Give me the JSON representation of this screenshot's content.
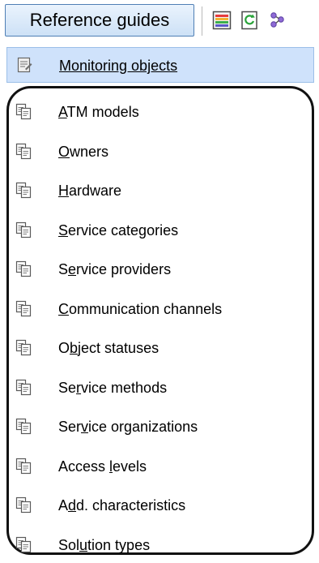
{
  "toolbar": {
    "reference_button_label": "Reference guides",
    "icons": [
      "list-view-icon",
      "refresh-icon",
      "flow-icon"
    ]
  },
  "selected_item": {
    "label": "Monitoring objects",
    "icon": "monitoring-objects-icon"
  },
  "items": [
    {
      "label": "ATM models",
      "underline_index": 0,
      "icon": "document-copy-icon"
    },
    {
      "label": "Owners",
      "underline_index": 0,
      "icon": "document-copy-icon"
    },
    {
      "label": "Hardware",
      "underline_index": 0,
      "icon": "document-copy-icon"
    },
    {
      "label": "Service categories",
      "underline_index": 0,
      "icon": "document-copy-icon"
    },
    {
      "label": "Service providers",
      "underline_index": 1,
      "icon": "document-copy-icon"
    },
    {
      "label": "Communication channels",
      "underline_index": 0,
      "icon": "document-copy-icon"
    },
    {
      "label": "Object statuses",
      "underline_index": 1,
      "icon": "document-copy-icon"
    },
    {
      "label": "Service methods",
      "underline_index": 2,
      "icon": "document-copy-icon"
    },
    {
      "label": "Service organizations",
      "underline_index": 3,
      "icon": "document-copy-icon"
    },
    {
      "label": "Access levels",
      "underline_index": 7,
      "icon": "document-copy-icon"
    },
    {
      "label": "Add. characteristics",
      "underline_index": 1,
      "icon": "document-copy-icon"
    },
    {
      "label": "Solution types",
      "underline_index": 3,
      "icon": "document-copy-icon"
    }
  ]
}
